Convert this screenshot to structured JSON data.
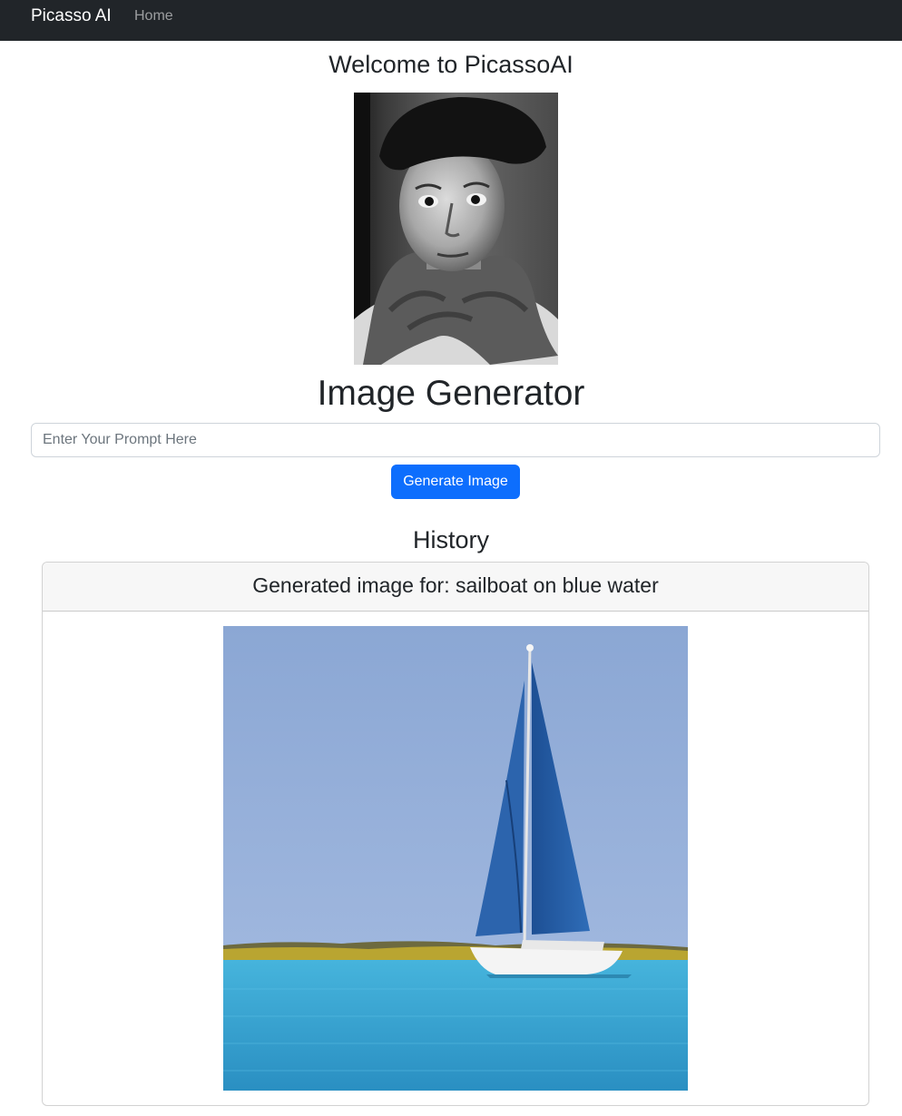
{
  "navbar": {
    "brand": "Picasso AI",
    "home_link": "Home"
  },
  "main": {
    "welcome_heading": "Welcome to PicassoAI",
    "portrait_subject": "black-and-white portrait photograph of Picasso in beret and scarf",
    "generator_heading": "Image Generator",
    "prompt_input": {
      "value": "",
      "placeholder": "Enter Your Prompt Here"
    },
    "generate_button_label": "Generate Image"
  },
  "history": {
    "heading": "History",
    "entries": [
      {
        "caption": "Generated image for: sailboat on blue water",
        "image_subject": "white sailboat with blue sails on turquoise water"
      }
    ]
  },
  "colors": {
    "navbar_bg": "#212529",
    "primary_button": "#0d6efd",
    "card_header_bg": "#f7f7f7",
    "sky": "#8ea9d6",
    "water": "#3aa3cf"
  }
}
